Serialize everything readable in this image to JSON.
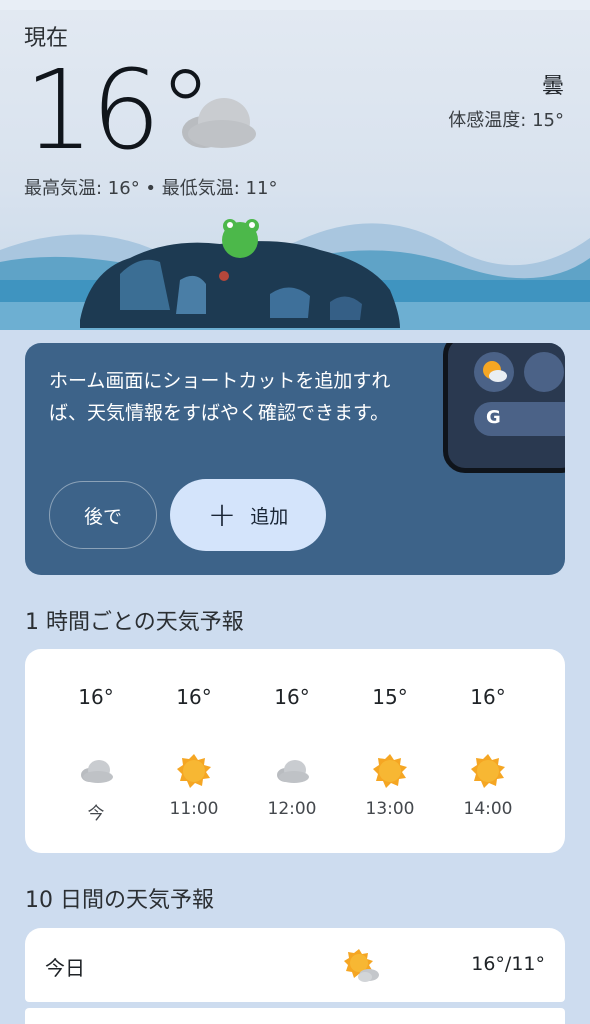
{
  "current": {
    "label": "現在",
    "temperature": "16°",
    "condition": "曇",
    "feels_like": "体感温度: 15°",
    "high_low": "最高気温: 16° • 最低気温: 11°",
    "icon": "cloudy-icon"
  },
  "promo": {
    "text": "ホーム画面にショートカットを追加すれば、天気情報をすばやく確認できます。",
    "later_label": "後で",
    "add_label": "追加",
    "mock_search_glyph": "G"
  },
  "hourly": {
    "title": "1 時間ごとの天気予報",
    "items": [
      {
        "temp": "16°",
        "icon": "cloudy-icon",
        "time": "今"
      },
      {
        "temp": "16°",
        "icon": "sunny-icon",
        "time": "11:00"
      },
      {
        "temp": "16°",
        "icon": "cloudy-icon",
        "time": "12:00"
      },
      {
        "temp": "15°",
        "icon": "sunny-icon",
        "time": "13:00"
      },
      {
        "temp": "16°",
        "icon": "sunny-icon",
        "time": "14:00"
      }
    ]
  },
  "daily": {
    "title": "10 日間の天気予報",
    "items": [
      {
        "day": "今日",
        "icon": "partly-cloudy-icon",
        "range": "16°/11°"
      }
    ]
  },
  "colors": {
    "background": "#cddcef",
    "promo_card": "#3d6389",
    "add_button": "#d4e4fb",
    "sun": "#f5a623"
  }
}
